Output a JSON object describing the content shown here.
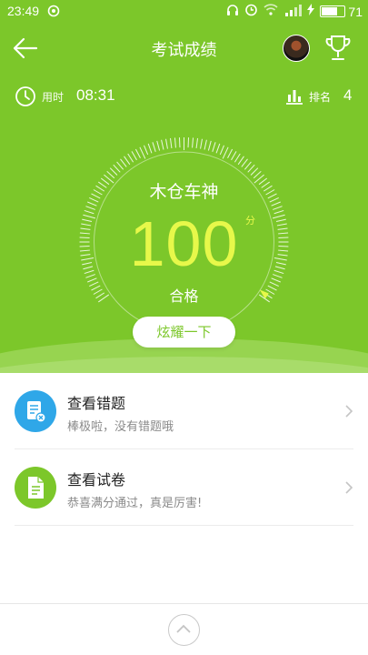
{
  "status_bar": {
    "time": "23:49",
    "battery": "71"
  },
  "header": {
    "title": "考试成绩"
  },
  "stats": {
    "time_label": "用时",
    "time_value": "08:31",
    "rank_label": "排名",
    "rank_value": "4"
  },
  "result": {
    "nickname": "木仓车神",
    "score": "100",
    "unit": "分",
    "verdict": "合格",
    "score_fraction": 1.0
  },
  "share_button": "炫耀一下",
  "items": [
    {
      "title": "查看错题",
      "subtitle": "棒极啦，没有错题哦",
      "icon": "wrong-questions-icon",
      "color": "#2fa7e8"
    },
    {
      "title": "查看试卷",
      "subtitle": "恭喜满分通过，真是厉害!",
      "icon": "exam-paper-icon",
      "color": "#7cc72a"
    }
  ],
  "colors": {
    "header_bg": "#7cc72a",
    "score": "#e7f84a"
  }
}
